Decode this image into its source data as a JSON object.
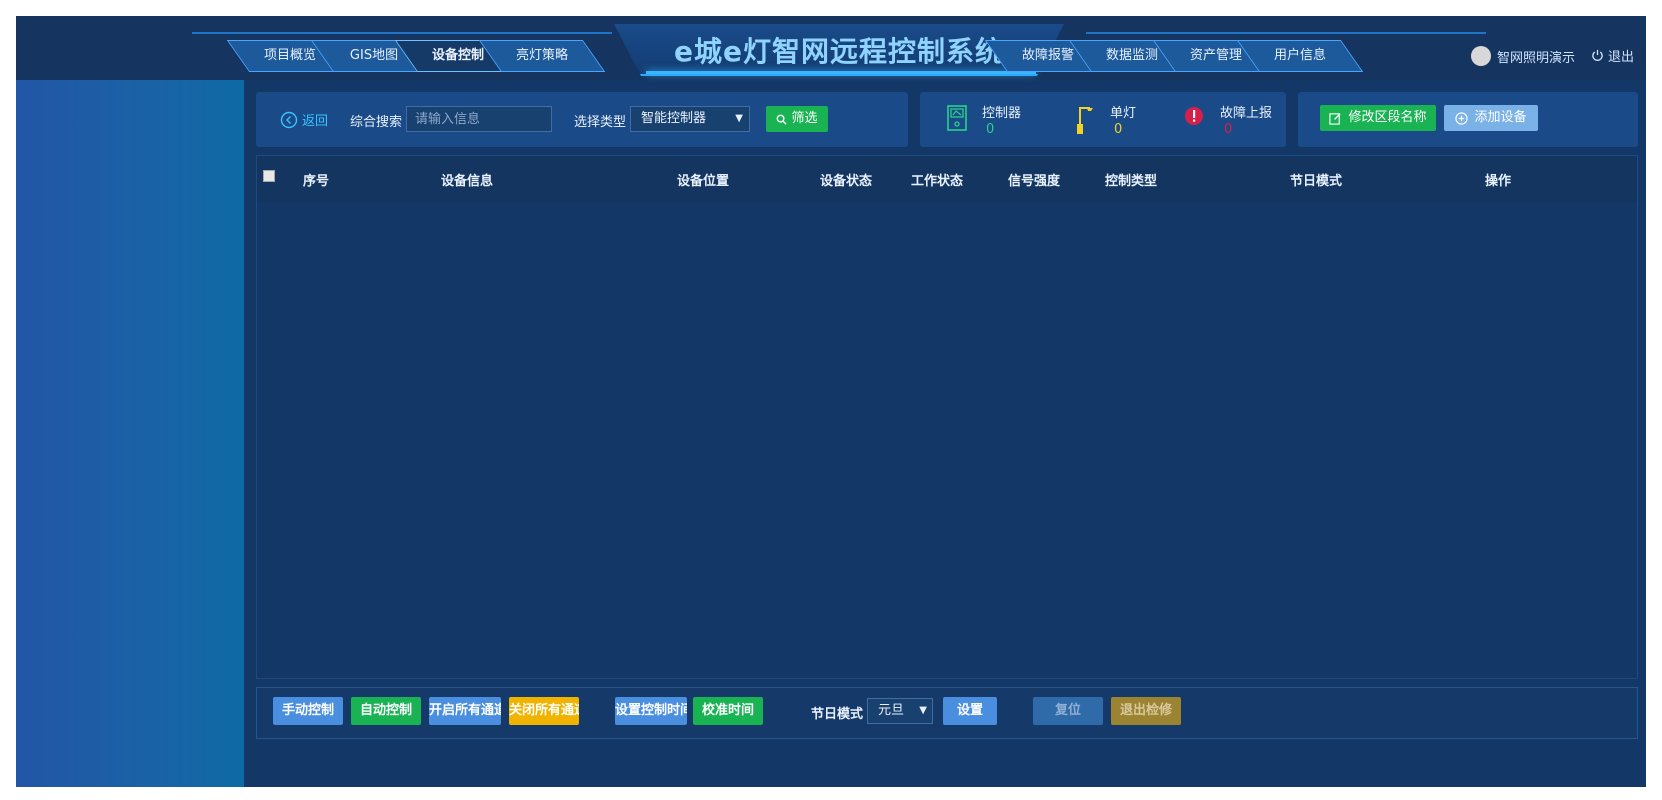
{
  "header": {
    "title": "e城e灯智网远程控制系统",
    "nav_left": [
      "项目概览",
      "GIS地图",
      "设备控制",
      "亮灯策略"
    ],
    "nav_right": [
      "故障报警",
      "数据监测",
      "资产管理",
      "用户信息"
    ],
    "active_tab": "设备控制",
    "user_name": "智网照明演示",
    "logout_label": "退出"
  },
  "search": {
    "back_label": "返回",
    "search_label": "综合搜索",
    "search_placeholder": "请输入信息",
    "type_label": "选择类型",
    "type_value": "智能控制器",
    "filter_label": "筛选"
  },
  "stats": [
    {
      "label": "控制器",
      "value": "0",
      "color": "#2ad18a"
    },
    {
      "label": "单灯",
      "value": "0",
      "color": "#f2d227"
    },
    {
      "label": "故障上报",
      "value": "0",
      "color": "#d6204a"
    }
  ],
  "actions": {
    "edit_label": "修改区段名称",
    "add_label": "添加设备"
  },
  "table": {
    "columns": [
      "序号",
      "设备信息",
      "设备位置",
      "设备状态",
      "工作状态",
      "信号强度",
      "控制类型",
      "节日模式",
      "操作"
    ],
    "rows": []
  },
  "bottom": {
    "manual": "手动控制",
    "auto": "自动控制",
    "open_all": "开启所有通道",
    "close_all": "关闭所有通道",
    "set_time": "设置控制时间",
    "calibrate": "校准时间",
    "holiday_label": "节日模式",
    "holiday_value": "元旦",
    "set": "设置",
    "reset": "复位",
    "exit_maint": "退出检修"
  },
  "colors": {
    "background": "#133766",
    "accent": "#38b6ff",
    "green": "#1ab354",
    "yellow": "#f0b400"
  }
}
